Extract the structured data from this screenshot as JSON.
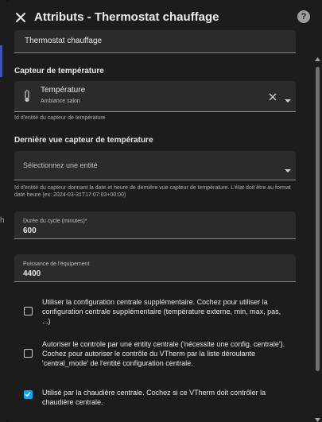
{
  "dialog": {
    "title": "Attributs - Thermostat chauffage",
    "close_icon": "close-icon",
    "help_icon": "help-icon"
  },
  "name_field": {
    "value": "Thermostat chauffage"
  },
  "temp_sensor": {
    "section_title": "Capteur de température",
    "entity_name": "Température",
    "entity_area": "Ambiance salon",
    "icon": "thermometer-icon",
    "helper": "Id d'entité du capteur de température"
  },
  "last_seen_sensor": {
    "section_title": "Dernière vue capteur de température",
    "placeholder": "Sélectionnez une entité",
    "helper": "Id d'entité du capteur donnant la date et heure de dernière vue capteur de température. L'état doit être au format date heure (ex: 2024-03-31T17:07:03+00:00)"
  },
  "cycle": {
    "label": "Durée du cycle (minutes)*",
    "value": "600"
  },
  "power": {
    "label": "Puissance de l'équipement",
    "value": "4400"
  },
  "options": [
    {
      "text": "Utiliser la configuration centrale supplémentaire. Cochez pour utiliser la configuration centrale supplémentaire (température externe, min, max, pas, ...)",
      "checked": false
    },
    {
      "text": "Autoriser le controle par une entity centrale ('nécessite une config. centrale'). Cochez pour autoriser le contrôle du VTherm par la liste déroulante 'central_mode' de l'entité configuration centrale.",
      "checked": false
    },
    {
      "text": "Utilisé par la chaudière centrale. Cochez si ce VTherm doit contrôler la chaudière centrale.",
      "checked": true
    }
  ],
  "colors": {
    "accent": "#03a9f4",
    "background": "#1c1c1c",
    "field": "#2b2b2b"
  }
}
